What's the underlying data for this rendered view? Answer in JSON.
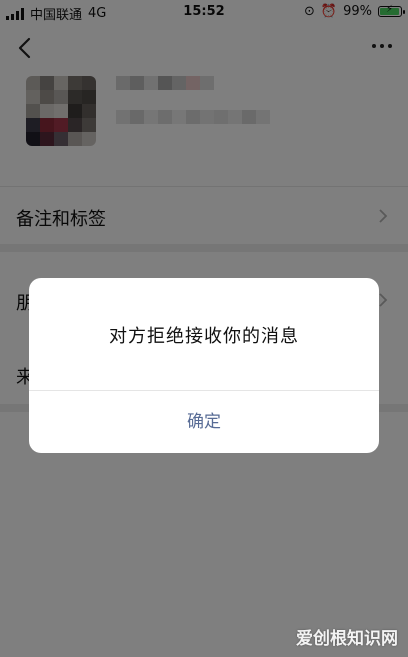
{
  "status_bar": {
    "carrier": "中国联通",
    "network": "4G",
    "time": "15:52",
    "battery": "99%",
    "battery_level": 0.99,
    "colors": {
      "battery_fill": "#4cd964"
    }
  },
  "nav": {
    "back_icon": "chevron-left-icon",
    "more_icon": "more-dots-icon"
  },
  "rows": [
    {
      "label": "备注和标签"
    },
    {
      "label": "朋"
    },
    {
      "label": "来"
    }
  ],
  "dialog": {
    "message": "对方拒绝接收你的消息",
    "confirm_label": "确定",
    "colors": {
      "confirm": "#576b95"
    }
  },
  "watermark": "爱创根知识网"
}
